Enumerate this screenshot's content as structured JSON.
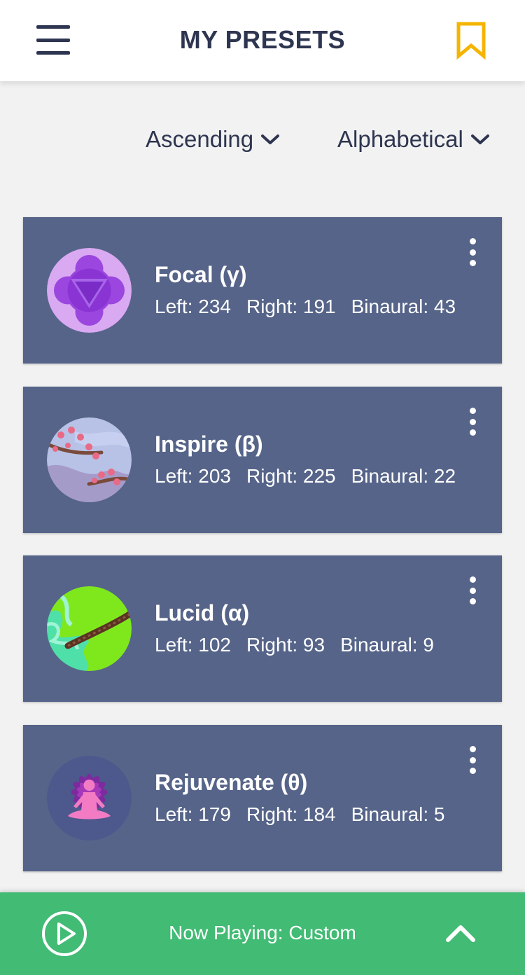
{
  "header": {
    "title": "MY PRESETS",
    "menu_icon": "hamburger-menu-icon",
    "bookmark_icon": "bookmark-icon",
    "accent_color": "#f4b400"
  },
  "sort": {
    "order_label": "Ascending",
    "type_label": "Alphabetical"
  },
  "presets": [
    {
      "name": "Focal (γ)",
      "left": "Left: 234",
      "right": "Right: 191",
      "binaural": "Binaural: 43",
      "icon": "chakra-triangle-icon"
    },
    {
      "name": "Inspire (β)",
      "left": "Left: 203",
      "right": "Right: 225",
      "binaural": "Binaural: 22",
      "icon": "cherry-blossom-icon"
    },
    {
      "name": "Lucid (α)",
      "left": "Left: 102",
      "right": "Right: 93",
      "binaural": "Binaural: 9",
      "icon": "green-branch-icon"
    },
    {
      "name": "Rejuvenate (θ)",
      "left": "Left: 179",
      "right": "Right: 184",
      "binaural": "Binaural: 5",
      "icon": "meditation-lotus-icon"
    }
  ],
  "player": {
    "now_playing": "Now Playing: Custom",
    "play_icon": "play-circle-icon",
    "expand_icon": "chevron-up-icon",
    "background_color": "#42bb74"
  },
  "colors": {
    "card_background": "#566489",
    "page_background": "#f2f2f2",
    "text_dark": "#2e3550"
  }
}
